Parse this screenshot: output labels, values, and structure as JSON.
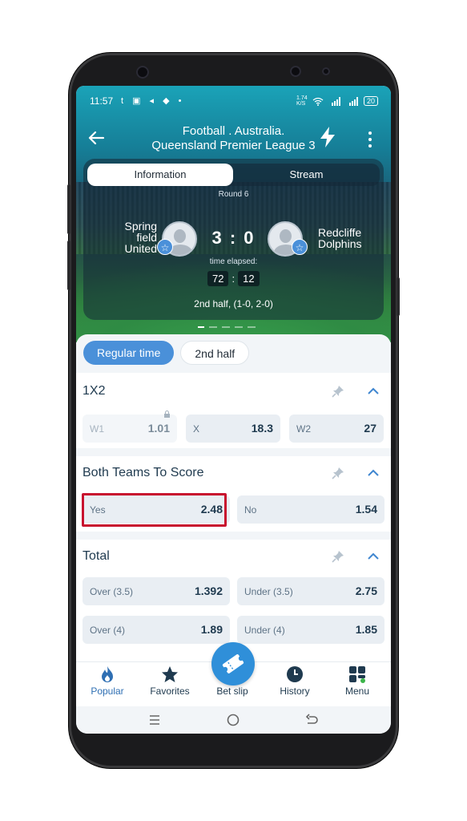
{
  "status_bar": {
    "time": "11:57",
    "left_icons": "t ▣ ◂ ◆ •",
    "net_speed": "1.74 K/S",
    "battery": "20"
  },
  "header": {
    "sport_line": "Football . Australia.",
    "league_line": "Queensland Premier League 3"
  },
  "match_tabs": {
    "information": "Information",
    "stream": "Stream"
  },
  "match": {
    "round": "Round 6",
    "home_team": "Spring field United",
    "home_team_line1": "Spring",
    "home_team_line2": "field",
    "home_team_line3": "United",
    "away_team_line1": "Redcliffe",
    "away_team_line2": "Dolphins",
    "score": "3 : 0",
    "elapsed_label": "time elapsed:",
    "elapsed_min": "72",
    "elapsed_sep": ":",
    "elapsed_sec": "12",
    "half_info": "2nd half, (1-0, 2-0)"
  },
  "period_tabs": [
    "Regular time",
    "2nd half"
  ],
  "markets": {
    "m1x2": {
      "title": "1X2",
      "odds": [
        {
          "label": "W1",
          "value": "1.01",
          "locked": true
        },
        {
          "label": "X",
          "value": "18.3"
        },
        {
          "label": "W2",
          "value": "27"
        }
      ]
    },
    "btts": {
      "title": "Both Teams To Score",
      "odds": [
        {
          "label": "Yes",
          "value": "2.48",
          "highlighted": true
        },
        {
          "label": "No",
          "value": "1.54"
        }
      ]
    },
    "total": {
      "title": "Total",
      "odds": [
        {
          "label": "Over (3.5)",
          "value": "1.392"
        },
        {
          "label": "Under (3.5)",
          "value": "2.75"
        },
        {
          "label": "Over (4)",
          "value": "1.89"
        },
        {
          "label": "Under (4)",
          "value": "1.85"
        }
      ]
    }
  },
  "bottom_nav": {
    "popular": "Popular",
    "favorites": "Favorites",
    "bet_slip": "Bet slip",
    "history": "History",
    "menu": "Menu"
  },
  "colors": {
    "accent": "#4a90d9",
    "highlight_border": "#c8102e",
    "text_dark": "#1f3a4f"
  }
}
